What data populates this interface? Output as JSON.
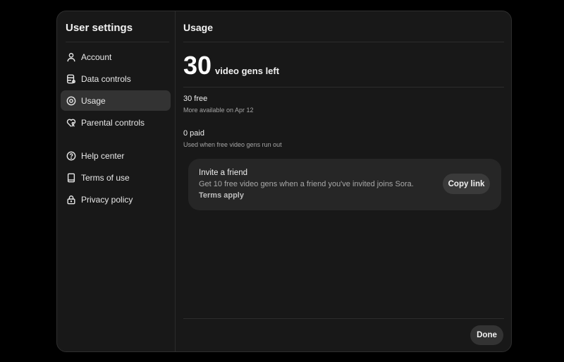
{
  "sidebar": {
    "title": "User settings",
    "items": [
      {
        "label": "Account",
        "icon": "user-icon"
      },
      {
        "label": "Data controls",
        "icon": "database-icon"
      },
      {
        "label": "Usage",
        "icon": "usage-icon",
        "active": true
      },
      {
        "label": "Parental controls",
        "icon": "parental-icon"
      },
      {
        "label": "Help center",
        "icon": "help-icon"
      },
      {
        "label": "Terms of use",
        "icon": "book-icon"
      },
      {
        "label": "Privacy policy",
        "icon": "lock-icon"
      }
    ]
  },
  "main": {
    "title": "Usage",
    "count": "30",
    "count_label": "video gens left",
    "free": {
      "label": "30 free",
      "sub": "More available on Apr 12"
    },
    "paid": {
      "label": "0 paid",
      "sub": "Used when free video gens run out"
    },
    "invite": {
      "title": "Invite a friend",
      "desc": "Get 10 free video gens when a friend you've invited joins Sora.",
      "terms": "Terms apply",
      "button": "Copy link"
    },
    "done": "Done"
  }
}
